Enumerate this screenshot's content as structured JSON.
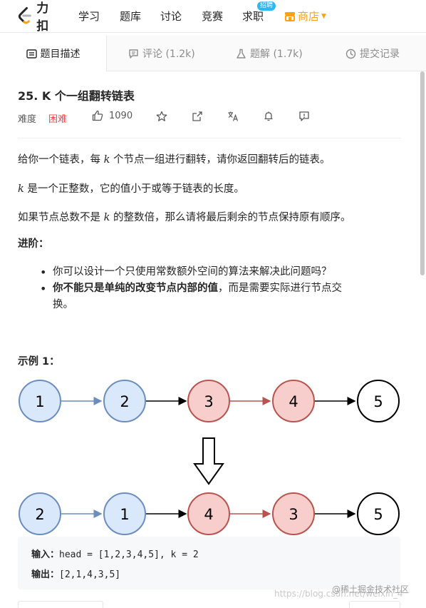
{
  "nav": {
    "logo_text": "力扣",
    "items": [
      "学习",
      "题库",
      "讨论",
      "竞赛",
      "求职"
    ],
    "badge": "招聘",
    "shop": "商店"
  },
  "tabs": [
    {
      "label": "题目描述"
    },
    {
      "label": "评论 (1.2k)"
    },
    {
      "label": "题解 (1.7k)"
    },
    {
      "label": "提交记录"
    }
  ],
  "problem": {
    "title": "25. K 个一组翻转链表",
    "difficulty_label": "难度",
    "difficulty": "困难",
    "likes": "1090"
  },
  "description": {
    "p1_pre": "给你一个链表，每 ",
    "p1_var": "k",
    "p1_post": " 个节点一组进行翻转，请你返回翻转后的链表。",
    "p2_var": "k",
    "p2_post": " 是一个正整数，它的值小于或等于链表的长度。",
    "p3_pre": "如果节点总数不是 ",
    "p3_var": "k",
    "p3_post": " 的整数倍，那么请将最后剩余的节点保持原有顺序。",
    "advanced_heading": "进阶：",
    "bullet1": "你可以设计一个只使用常数额外空间的算法来解决此问题吗？",
    "bullet2_bold": "你不能只是单纯的改变节点内部的值",
    "bullet2_rest1": "，而是需要实际进行节点交",
    "bullet2_rest2": "换。",
    "example_heading": "示例 1："
  },
  "diagram": {
    "row1": [
      "1",
      "2",
      "3",
      "4",
      "5"
    ],
    "row2": [
      "2",
      "1",
      "4",
      "3",
      "5"
    ],
    "colors": {
      "blue_fill": "#dae8fc",
      "blue_stroke": "#6c8ebf",
      "red_fill": "#f8cecc",
      "red_stroke": "#b85450",
      "white_fill": "#ffffff",
      "black_stroke": "#000000"
    }
  },
  "example": {
    "input_label": "输入：",
    "input_value": "head = [1,2,3,4,5], k = 2",
    "output_label": "输出：",
    "output_value": "[2,1,4,3,5]"
  },
  "watermark": {
    "juejin": "@稀土掘金技术社区",
    "csdn": "https://blog.csdn.net/weixin_4"
  },
  "accent": "#ffa116"
}
